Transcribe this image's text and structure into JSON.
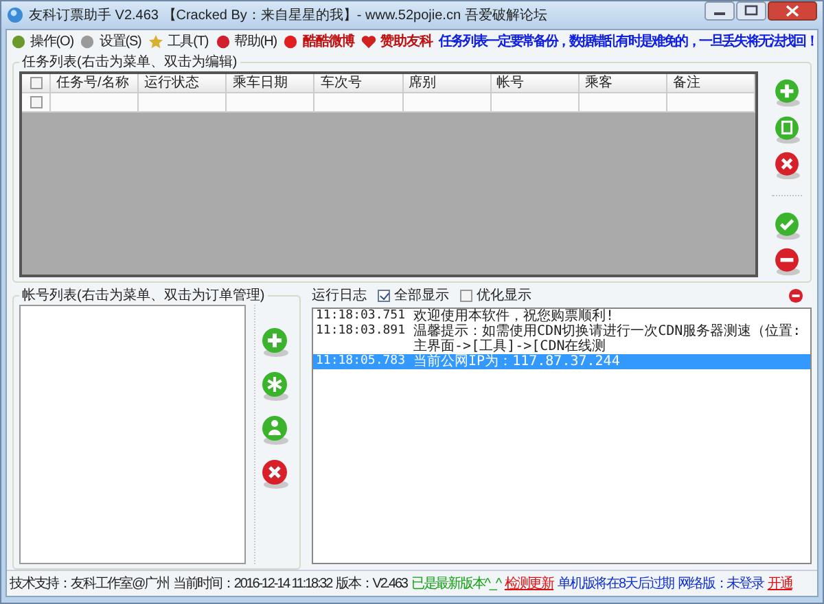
{
  "window": {
    "title": "友科订票助手 V2.463 【Cracked By：来自星星的我】- www.52pojie.cn 吾爱破解论坛"
  },
  "menu": [
    {
      "label": "操作(O)",
      "kind": "person"
    },
    {
      "label": "设置(S)",
      "kind": "gear"
    },
    {
      "label": "工具(T)",
      "kind": "star"
    },
    {
      "label": "帮助(H)",
      "kind": "help"
    },
    {
      "label": "酷酷微博",
      "kind": "weibo"
    },
    {
      "label": "赞助友科",
      "kind": "heart"
    }
  ],
  "notice": "任务列表一定要常备份，数据错乱有时是难免的，一旦丢失将无法找回！",
  "task_list": {
    "title": "任务列表(右击为菜单、双击为编辑)",
    "header_checked": false,
    "columns": [
      "任务号/名称",
      "运行状态",
      "乘车日期",
      "车次号",
      "席别",
      "帐号",
      "乘客",
      "备注"
    ],
    "rows": [
      {
        "checked": false
      }
    ],
    "buttons": [
      {
        "kind": "add"
      },
      {
        "kind": "copy"
      },
      {
        "kind": "delete"
      },
      {
        "kind": "ok"
      },
      {
        "kind": "remove"
      }
    ]
  },
  "account_list": {
    "title": "帐号列表(右击为菜单、双击为订单管理)",
    "buttons": [
      {
        "kind": "add"
      },
      {
        "kind": "asterisk"
      },
      {
        "kind": "user"
      },
      {
        "kind": "delete"
      }
    ]
  },
  "log": {
    "title": "运行日志",
    "options": [
      {
        "label": "全部显示",
        "checked": true
      },
      {
        "label": "优化显示",
        "checked": false
      }
    ],
    "entries": [
      {
        "time": "11:18:03.751",
        "text": "欢迎使用本软件，祝您购票顺利!",
        "selected": false
      },
      {
        "time": "11:18:03.891",
        "text": "温馨提示：如需使用CDN切换请进行一次CDN服务器测速（位置:主界面->[工具]->[CDN在线测",
        "selected": false
      },
      {
        "time": "11:18:05.783",
        "text": "当前公网IP为：117.87.37.244",
        "selected": true
      }
    ]
  },
  "status_bar": [
    {
      "text": "技术支持：友科工作室@广州",
      "kind": "plain"
    },
    {
      "text": "当前时间：2016-12-14 11:18:32",
      "kind": "plain"
    },
    {
      "text": "版本：V2.463",
      "kind": "plain"
    },
    {
      "text": "已是最新版本^_^",
      "kind": "good"
    },
    {
      "text": "检测更新",
      "kind": "link"
    },
    {
      "text": "单机版将在8天后过期",
      "kind": "info"
    },
    {
      "text": "网络版：未登录",
      "kind": "info"
    },
    {
      "text": "开通",
      "kind": "link"
    }
  ]
}
